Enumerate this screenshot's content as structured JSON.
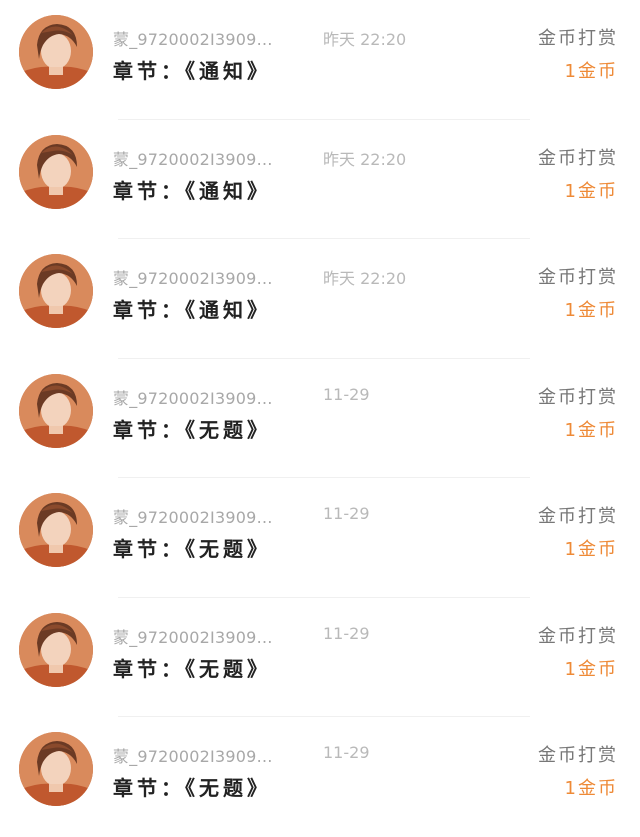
{
  "colors": {
    "accent": "#ee8a37",
    "username": "#a8a8a8",
    "time": "#b9b9b9",
    "content": "#222222",
    "type": "#777777",
    "divider": "#f0f0f0"
  },
  "records": [
    {
      "avatar": "user-avatar",
      "username": "蒙_9720002I3909…",
      "time": "昨天 22:20",
      "content": "章节：《通知》",
      "type": "金币打赏",
      "amount": "1金币"
    },
    {
      "avatar": "user-avatar",
      "username": "蒙_9720002I3909…",
      "time": "昨天 22:20",
      "content": "章节：《通知》",
      "type": "金币打赏",
      "amount": "1金币"
    },
    {
      "avatar": "user-avatar",
      "username": "蒙_9720002I3909…",
      "time": "昨天 22:20",
      "content": "章节：《通知》",
      "type": "金币打赏",
      "amount": "1金币"
    },
    {
      "avatar": "user-avatar",
      "username": "蒙_9720002I3909…",
      "time": "11-29",
      "content": "章节：《无题》",
      "type": "金币打赏",
      "amount": "1金币"
    },
    {
      "avatar": "user-avatar",
      "username": "蒙_9720002I3909…",
      "time": "11-29",
      "content": "章节：《无题》",
      "type": "金币打赏",
      "amount": "1金币"
    },
    {
      "avatar": "user-avatar",
      "username": "蒙_9720002I3909…",
      "time": "11-29",
      "content": "章节：《无题》",
      "type": "金币打赏",
      "amount": "1金币"
    },
    {
      "avatar": "user-avatar",
      "username": "蒙_9720002I3909…",
      "time": "11-29",
      "content": "章节：《无题》",
      "type": "金币打赏",
      "amount": "1金币"
    }
  ]
}
